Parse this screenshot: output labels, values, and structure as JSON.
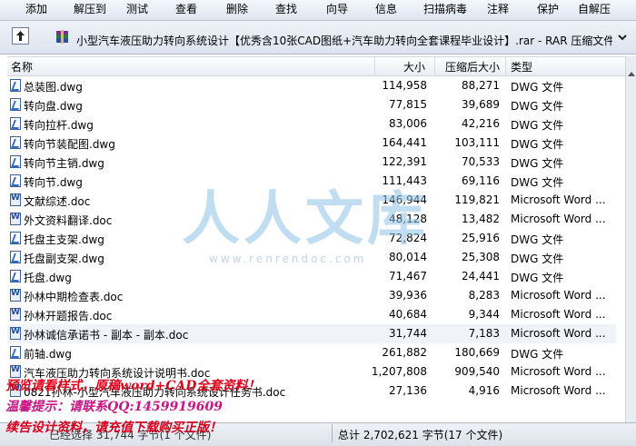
{
  "toolbar": {
    "buttons": [
      "添加",
      "解压到",
      "测试",
      "查看",
      "删除",
      "查找",
      "向导",
      "信息",
      "扫描病毒",
      "注释",
      "保护",
      "自解压"
    ]
  },
  "address": {
    "text": "小型汽车液压助力转向系统设计【优秀含10张CAD图纸+汽车助力转向全套课程毕业设计】.rar - RAR 压缩文件"
  },
  "columns": {
    "name": "名称",
    "size": "大小",
    "packed": "压缩后大小",
    "type": "类型"
  },
  "files": [
    {
      "name": "总装图.dwg",
      "size": "114,958",
      "packed": "88,271",
      "type": "DWG 文件",
      "icon": "dwg-file-icon"
    },
    {
      "name": "转向盘.dwg",
      "size": "77,815",
      "packed": "39,689",
      "type": "DWG 文件",
      "icon": "dwg-file-icon"
    },
    {
      "name": "转向拉杆.dwg",
      "size": "83,006",
      "packed": "42,216",
      "type": "DWG 文件",
      "icon": "dwg-file-icon"
    },
    {
      "name": "转向节装配图.dwg",
      "size": "164,441",
      "packed": "103,111",
      "type": "DWG 文件",
      "icon": "dwg-file-icon"
    },
    {
      "name": "转向节主销.dwg",
      "size": "122,391",
      "packed": "70,533",
      "type": "DWG 文件",
      "icon": "dwg-file-icon"
    },
    {
      "name": "转向节.dwg",
      "size": "111,443",
      "packed": "69,116",
      "type": "DWG 文件",
      "icon": "dwg-file-icon"
    },
    {
      "name": "文献综述.doc",
      "size": "146,944",
      "packed": "119,821",
      "type": "Microsoft Word ...",
      "icon": "word-file-icon"
    },
    {
      "name": "外文资料翻译.doc",
      "size": "48,128",
      "packed": "13,482",
      "type": "Microsoft Word ...",
      "icon": "word-file-icon"
    },
    {
      "name": "托盘主支架.dwg",
      "size": "72,824",
      "packed": "25,916",
      "type": "DWG 文件",
      "icon": "dwg-file-icon"
    },
    {
      "name": "托盘副支架.dwg",
      "size": "80,014",
      "packed": "25,308",
      "type": "DWG 文件",
      "icon": "dwg-file-icon"
    },
    {
      "name": "托盘.dwg",
      "size": "71,467",
      "packed": "24,441",
      "type": "DWG 文件",
      "icon": "dwg-file-icon"
    },
    {
      "name": "孙林中期检查表.doc",
      "size": "39,936",
      "packed": "8,283",
      "type": "Microsoft Word ...",
      "icon": "word-file-icon"
    },
    {
      "name": "孙林开题报告.doc",
      "size": "40,684",
      "packed": "9,344",
      "type": "Microsoft Word ...",
      "icon": "word-file-icon"
    },
    {
      "name": "孙林诚信承诺书 - 副本 - 副本.doc",
      "size": "31,744",
      "packed": "7,183",
      "type": "Microsoft Word ...",
      "icon": "word-file-icon"
    },
    {
      "name": "前轴.dwg",
      "size": "261,882",
      "packed": "180,669",
      "type": "DWG 文件",
      "icon": "dwg-file-icon"
    },
    {
      "name": "汽车液压助力转向系统设计说明书.doc",
      "size": "1,207,808",
      "packed": "909,540",
      "type": "Microsoft Word ...",
      "icon": "word-file-icon"
    },
    {
      "name": "0821孙林-小型汽车液压助力转向系统设计任务书.doc",
      "size": "27,136",
      "packed": "4,916",
      "type": "Microsoft Word ...",
      "icon": "word-file-icon"
    }
  ],
  "status": {
    "selected": "已经选择 31,744 字节(1 个文件)",
    "total": "总计 2,702,621 字节(17 个文件)"
  },
  "watermark": {
    "text": "人人文库",
    "url": "www.renrendoc.com"
  },
  "promo": {
    "line1": "预览请看样式，原稿word+CAD全套资料！",
    "line2": "温馨提示：请联系QQ:1459919609",
    "line3": "续告设计资料，请充值下载购买正版！"
  }
}
